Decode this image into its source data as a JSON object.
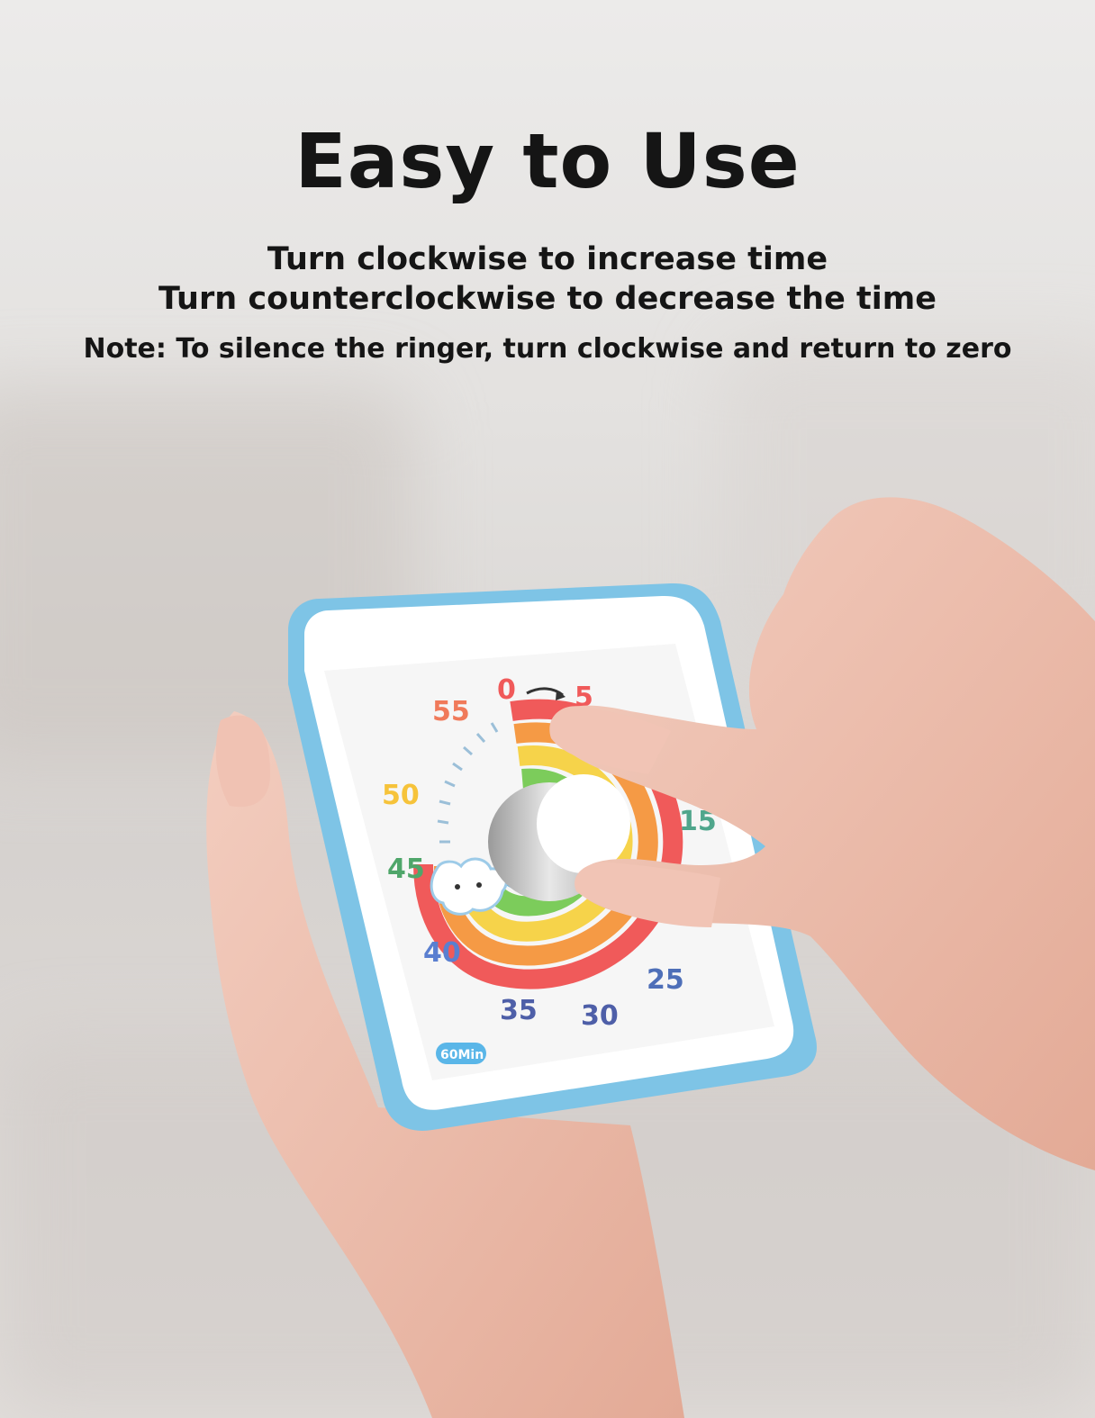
{
  "headline": {
    "title": "Easy to Use",
    "line1": "Turn clockwise to increase time",
    "line2": "Turn counterclockwise to decrease the time",
    "note": "Note: To silence the ringer, turn clockwise and return to zero"
  },
  "timer": {
    "badge": "60Min",
    "dial_numbers": [
      "0",
      "5",
      "15",
      "25",
      "30",
      "35",
      "40",
      "45",
      "50",
      "55"
    ],
    "colors": {
      "frame": "#7ec4e6",
      "face": "#f6f6f6",
      "rainbow": [
        "#f05a5a",
        "#f59a45",
        "#f6d34a",
        "#7ccc5b",
        "#5ab6e8",
        "#6f6fd6"
      ]
    }
  }
}
